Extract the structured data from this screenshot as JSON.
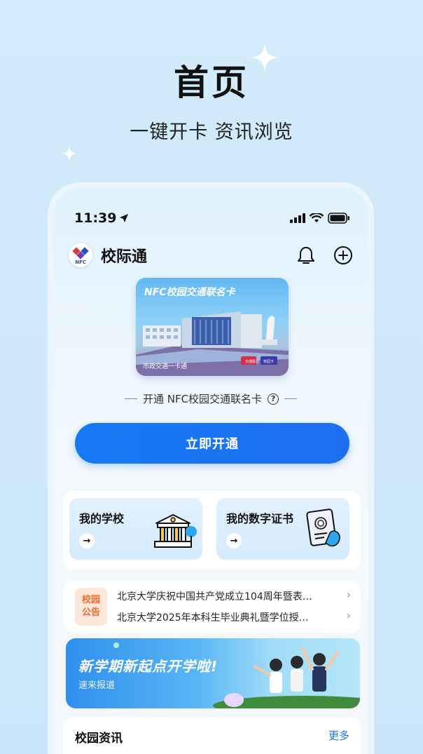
{
  "hero": {
    "title": "首页",
    "subtitle": "一键开卡 资讯浏览"
  },
  "status_bar": {
    "time": "11:39"
  },
  "header": {
    "logo_text": "NFC",
    "app_name": "校际通",
    "icons": [
      "bell-icon",
      "plus-circle-icon"
    ]
  },
  "nfc_card": {
    "title": "NFC校园交通联名卡",
    "footer": "市政交通一卡通",
    "badge_1": "交通联合",
    "badge_2": "校园卡"
  },
  "open_hint": {
    "text": "开通 NFC校园交通联名卡",
    "help_symbol": "?"
  },
  "open_button": {
    "label": "立即开通"
  },
  "tiles": [
    {
      "label": "我的学校",
      "icon": "school-building-icon"
    },
    {
      "label": "我的数字证书",
      "icon": "certificate-icon"
    }
  ],
  "announcements": {
    "badge_line1": "校园",
    "badge_line2": "公告",
    "items": [
      "北京大学庆祝中国共产党成立104周年暨表…",
      "北京大学2025年本科生毕业典礼暨学位授…"
    ]
  },
  "banner": {
    "title": "新学期新起点开学啦!",
    "subtitle": "速来报道"
  },
  "campus_news": {
    "title": "校园资讯",
    "more": "更多"
  },
  "colors": {
    "accent": "#1679f3",
    "announcement": "#f06a2c"
  }
}
